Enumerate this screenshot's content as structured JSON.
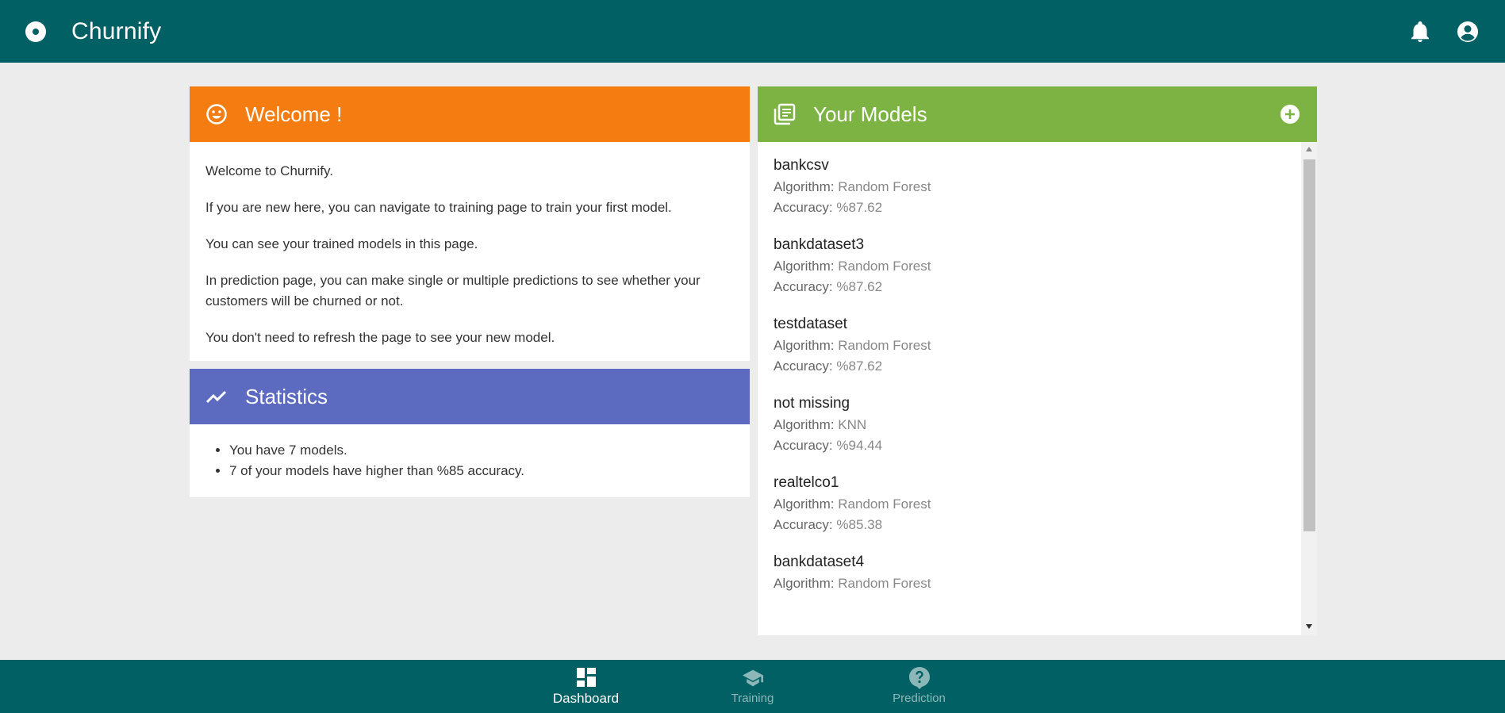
{
  "app": {
    "title": "Churnify"
  },
  "welcome": {
    "title": "Welcome !",
    "paragraphs": [
      "Welcome to Churnify.",
      "If you are new here, you can navigate to training page to train your first model.",
      "You can see your trained models in this page.",
      "In prediction page, you can make single or multiple predictions to see whether your customers will be churned or not.",
      "You don't need to refresh the page to see your new model."
    ]
  },
  "statistics": {
    "title": "Statistics",
    "items": [
      "You have 7 models.",
      "7 of your models have higher than %85 accuracy."
    ]
  },
  "models": {
    "title": "Your Models",
    "algorithm_label": "Algorithm:",
    "accuracy_label": "Accuracy:",
    "items": [
      {
        "name": "bankcsv",
        "algorithm": "Random Forest",
        "accuracy": "%87.62"
      },
      {
        "name": "bankdataset3",
        "algorithm": "Random Forest",
        "accuracy": "%87.62"
      },
      {
        "name": "testdataset",
        "algorithm": "Random Forest",
        "accuracy": "%87.62"
      },
      {
        "name": "not missing",
        "algorithm": "KNN",
        "accuracy": "%94.44"
      },
      {
        "name": "realtelco1",
        "algorithm": "Random Forest",
        "accuracy": "%85.38"
      },
      {
        "name": "bankdataset4",
        "algorithm": "Random Forest",
        "accuracy": ""
      }
    ]
  },
  "bottom_nav": [
    {
      "label": "Dashboard",
      "icon": "dashboard-icon",
      "active": true
    },
    {
      "label": "Training",
      "icon": "school-icon",
      "active": false
    },
    {
      "label": "Prediction",
      "icon": "help-icon",
      "active": false
    }
  ],
  "colors": {
    "primary": "#006064",
    "welcome_header": "#f57c10",
    "statistics_header": "#5c6bc0",
    "models_header": "#7cb342",
    "background": "#ececec"
  }
}
